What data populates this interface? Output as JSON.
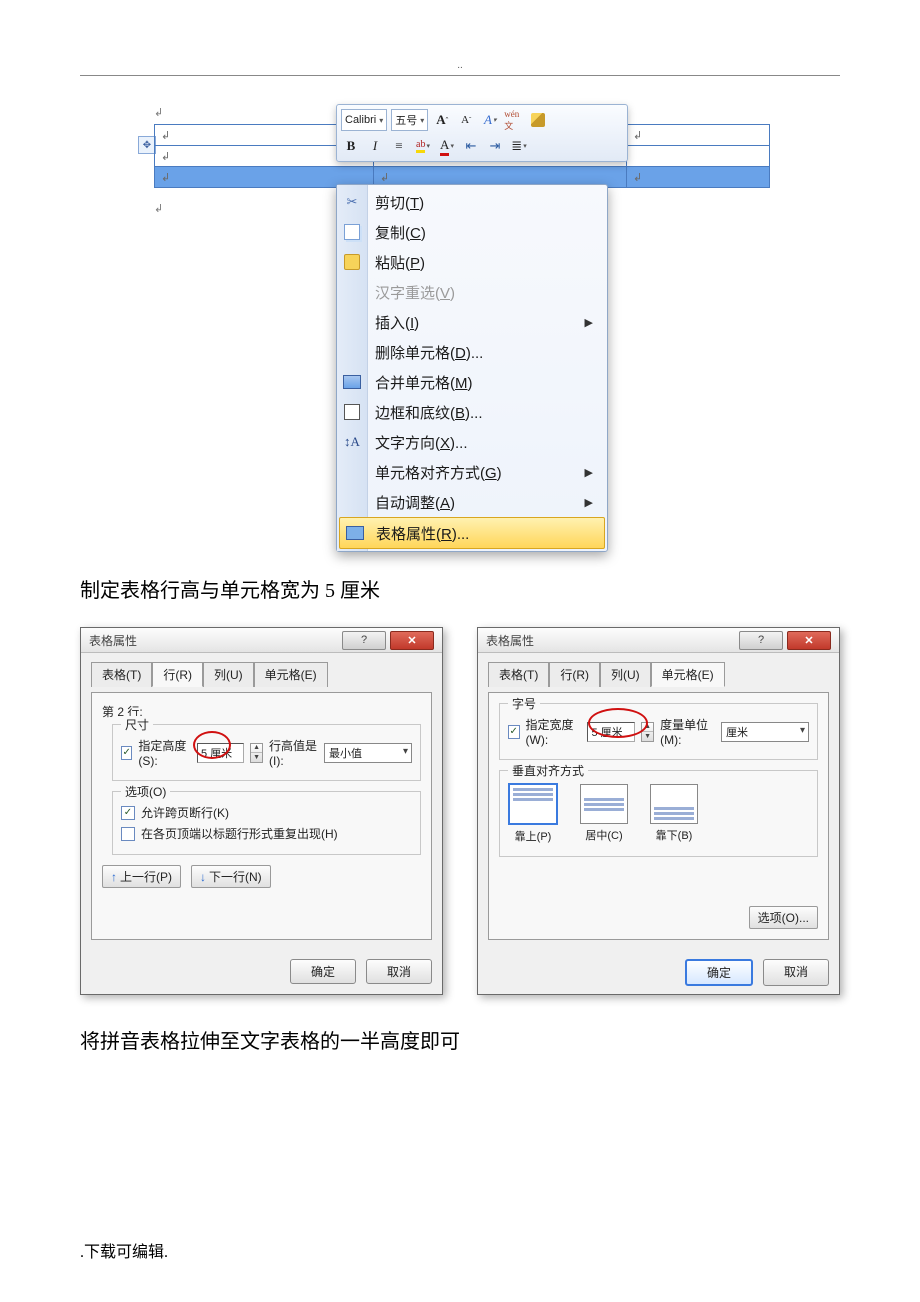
{
  "header_mark": "..",
  "shot1": {
    "para_marks": [
      "↲",
      "↲",
      "↲",
      "↲",
      "↲",
      "↲"
    ],
    "move_handle": "✥",
    "mini_toolbar": {
      "font": "Calibri",
      "size": "五号",
      "grow": "A",
      "shrink": "A",
      "style": "A",
      "phonetic": "wén文",
      "bold": "B",
      "italic": "I",
      "justify": "≡",
      "highlight": "ab",
      "fontcolor": "A",
      "dec_indent": "⇤",
      "inc_indent": "⇥",
      "list": "≣"
    },
    "menu": {
      "cut": "剪切(T)",
      "copy": "复制(C)",
      "paste": "粘贴(P)",
      "ime": "汉字重选(V)",
      "insert": "插入(I)",
      "delete_cells": "删除单元格(D)...",
      "merge_cells": "合并单元格(M)",
      "borders": "边框和底纹(B)...",
      "text_dir": "文字方向(X)...",
      "cell_align": "单元格对齐方式(G)",
      "autofit": "自动调整(A)",
      "table_props": "表格属性(R)..."
    }
  },
  "para1": "制定表格行高与单元格宽为 5 厘米",
  "dialog_title": "表格属性",
  "help_sym": "?",
  "close_sym": "✕",
  "dlg1": {
    "tabs": {
      "table": "表格(T)",
      "row": "行(R)",
      "col": "列(U)",
      "cell": "单元格(E)"
    },
    "row_label": "第 2 行:",
    "size_group": "尺寸",
    "spec_height": "指定高度(S):",
    "height_val": "5 厘米",
    "rowheight_is": "行高值是(I):",
    "min_val": "最小值",
    "options_group": "选项(O)",
    "allow_break": "允许跨页断行(K)",
    "repeat_header": "在各页顶端以标题行形式重复出现(H)",
    "prev_row": "上一行(P)",
    "next_row": "下一行(N)",
    "ok": "确定",
    "cancel": "取消"
  },
  "dlg2": {
    "size_group": "字号",
    "spec_width": "指定宽度(W):",
    "width_val": "5 厘米",
    "unit_label": "度量单位(M):",
    "unit_val": "厘米",
    "valign_group": "垂直对齐方式",
    "top": "靠上(P)",
    "center": "居中(C)",
    "bottom": "靠下(B)",
    "options_btn": "选项(O)...",
    "ok": "确定",
    "cancel": "取消"
  },
  "para2": "将拼音表格拉伸至文字表格的一半高度即可",
  "footer": ".下载可编辑."
}
